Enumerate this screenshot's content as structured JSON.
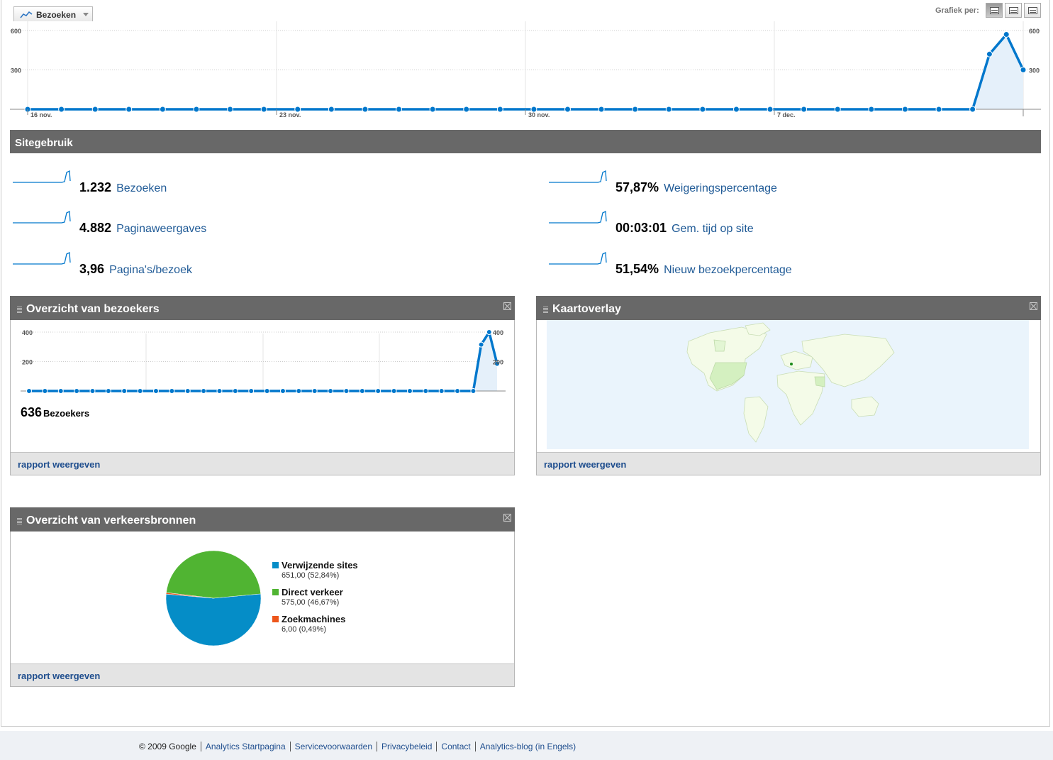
{
  "chart_selector": {
    "metric": "Bezoeken",
    "grafiek_per": "Grafiek per:"
  },
  "colors": {
    "line": "#0077cc",
    "area": "#e5f0fa",
    "header": "#686868",
    "link": "#1f5a96",
    "pie_referral": "#058dc7",
    "pie_direct": "#50b432",
    "pie_search": "#ed561b"
  },
  "chart_data": [
    {
      "type": "area",
      "y_ticks": [
        "600",
        "300"
      ],
      "ylim": [
        0,
        600
      ],
      "x_labels": [
        "16 nov.",
        "23 nov.",
        "30 nov.",
        "7 dec."
      ],
      "values": [
        0,
        0,
        0,
        0,
        0,
        0,
        0,
        0,
        0,
        0,
        0,
        0,
        0,
        0,
        0,
        0,
        0,
        0,
        0,
        0,
        0,
        0,
        0,
        0,
        0,
        0,
        0,
        0,
        0,
        0,
        0,
        0,
        0,
        0,
        0,
        0,
        0,
        0,
        0,
        0,
        0,
        0,
        0,
        0,
        0,
        0,
        0,
        0,
        0,
        0,
        0,
        0,
        0,
        0,
        0,
        0,
        0,
        420,
        570,
        300
      ],
      "grid": true
    },
    {
      "type": "area",
      "y_ticks": [
        "400",
        "200"
      ],
      "ylim": [
        0,
        400
      ],
      "values": [
        0,
        0,
        0,
        0,
        0,
        0,
        0,
        0,
        0,
        0,
        0,
        0,
        0,
        0,
        0,
        0,
        0,
        0,
        0,
        0,
        0,
        0,
        0,
        0,
        0,
        0,
        0,
        0,
        0,
        0,
        0,
        0,
        0,
        0,
        0,
        0,
        0,
        0,
        0,
        0,
        0,
        0,
        0,
        0,
        0,
        0,
        0,
        0,
        0,
        0,
        0,
        0,
        0,
        0,
        0,
        0,
        0,
        315,
        400,
        185
      ],
      "grid": true
    },
    {
      "type": "pie",
      "categories": [
        "Verwijzende sites",
        "Direct verkeer",
        "Zoekmachines"
      ],
      "values": [
        651,
        575,
        6
      ],
      "value_labels": [
        "651,00 (52,84%)",
        "575,00 (46,67%)",
        "6,00 (0,49%)"
      ]
    }
  ],
  "sitegebruik": {
    "title": "Sitegebruik",
    "metrics": [
      {
        "value": "1.232",
        "name": "Bezoeken"
      },
      {
        "value": "4.882",
        "name": "Paginaweergaves"
      },
      {
        "value": "3,96",
        "name": "Pagina's/bezoek"
      },
      {
        "value": "57,87%",
        "name": "Weigeringspercentage"
      },
      {
        "value": "00:03:01",
        "name": "Gem. tijd op site"
      },
      {
        "value": "51,54%",
        "name": "Nieuw bezoekpercentage"
      }
    ]
  },
  "widgets": {
    "visitors": {
      "title": "Overzicht van bezoekers",
      "count": "636",
      "count_unit": "Bezoekers",
      "link": "rapport weergeven"
    },
    "map": {
      "title": "Kaartoverlay",
      "link": "rapport weergeven"
    },
    "traffic": {
      "title": "Overzicht van verkeersbronnen",
      "link": "rapport weergeven"
    }
  },
  "footer": {
    "copyright": "© 2009 Google",
    "links": [
      "Analytics Startpagina",
      "Servicevoorwaarden",
      "Privacybeleid",
      "Contact",
      "Analytics-blog (in Engels)"
    ]
  }
}
